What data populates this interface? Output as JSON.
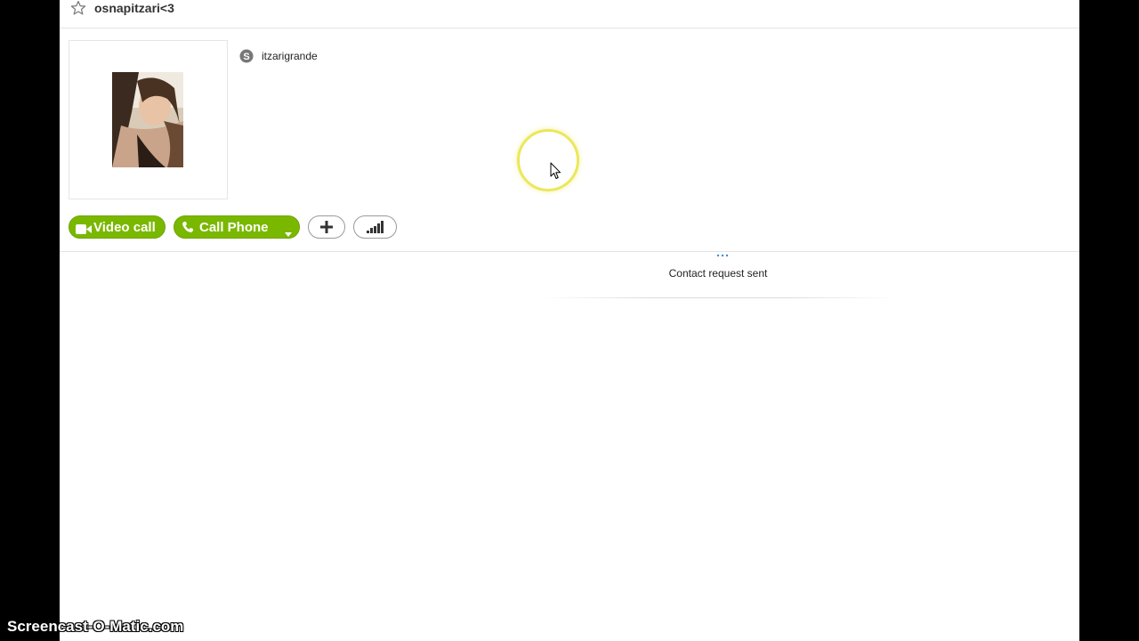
{
  "header": {
    "contact_name": "osnapitzari<3"
  },
  "profile": {
    "skype_name": "itzarigrande"
  },
  "actions": {
    "video_call_label": "Video call",
    "call_phone_label": "Call Phone"
  },
  "conversation": {
    "status_message": "Contact request sent"
  },
  "colors": {
    "accent_green": "#7ab800",
    "cursor_highlight": "#ece75a"
  },
  "watermark": {
    "text": "Screencast-O-Matic.com"
  }
}
